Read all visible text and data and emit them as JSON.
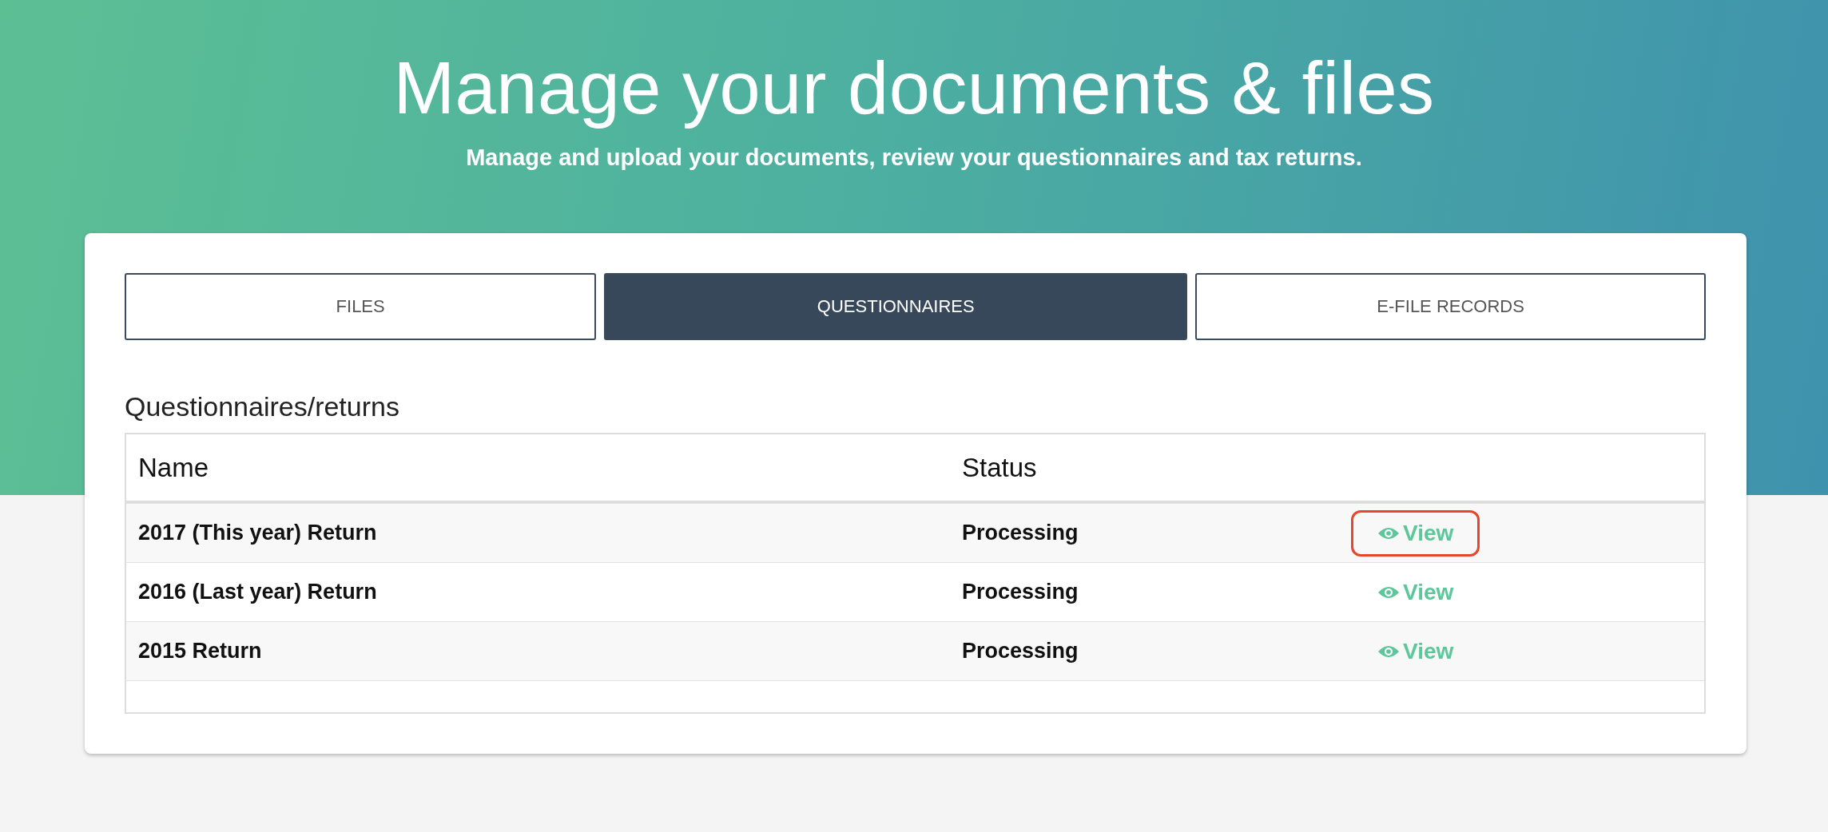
{
  "header": {
    "title": "Manage your documents & files",
    "subtitle": "Manage and upload your documents, review your questionnaires and tax returns."
  },
  "tabs": [
    {
      "label": "FILES",
      "selected": false
    },
    {
      "label": "QUESTIONNAIRES",
      "selected": true
    },
    {
      "label": "E-FILE RECORDS",
      "selected": false
    }
  ],
  "section_title": "Questionnaires/returns",
  "table": {
    "columns": [
      "Name",
      "Status"
    ],
    "rows": [
      {
        "name": "2017 (This year) Return",
        "status": "Processing",
        "action": "View",
        "highlighted": true
      },
      {
        "name": "2016 (Last year) Return",
        "status": "Processing",
        "action": "View",
        "highlighted": false
      },
      {
        "name": "2015 Return",
        "status": "Processing",
        "action": "View",
        "highlighted": false
      }
    ]
  }
}
